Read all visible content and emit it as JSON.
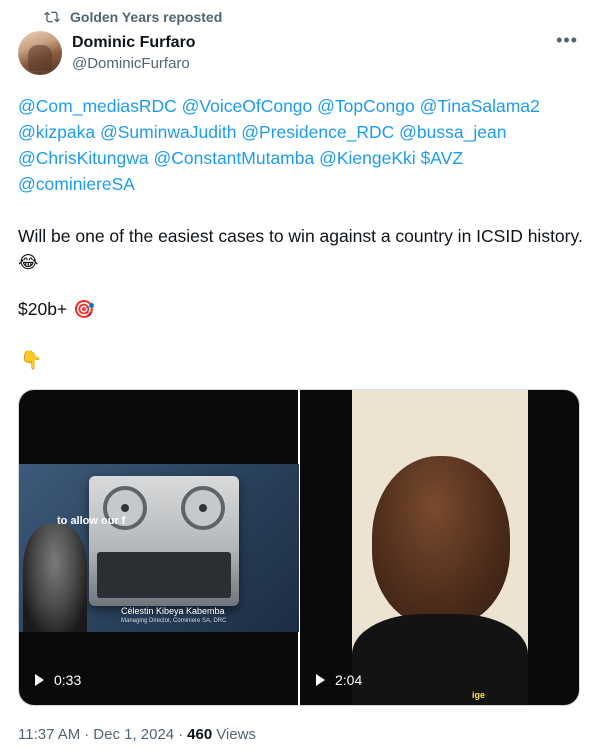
{
  "repost": {
    "icon": "repost-icon",
    "label": "Golden Years reposted"
  },
  "author": {
    "name": "Dominic Furfaro",
    "handle": "@DominicFurfaro",
    "avatar": "avatar"
  },
  "more_icon": "more-icon",
  "mentions": [
    "@Com_mediasRDC",
    "@VoiceOfCongo",
    "@TopCongo",
    "@TinaSalama2",
    "@kizpaka",
    "@SuminwaJudith",
    "@Presidence_RDC",
    "@bussa_jean",
    "@ChrisKitungwa",
    "@ConstantMutamba",
    "@KiengeKki",
    "$AVZ",
    "@cominiereSA"
  ],
  "body": {
    "text": "Will be one of the easiest cases to win against a country in ICSID history.",
    "emoji": "😂"
  },
  "price": {
    "text": "$20b+",
    "emoji": "🎯"
  },
  "pointer_emoji": "👇",
  "videos": [
    {
      "duration": "0:33",
      "caption": "to allow our f",
      "person_name": "Célestin Kibeya Kabemba",
      "person_role": "Managing Director, Cominiere SA, DRC"
    },
    {
      "duration": "2:04",
      "caption": "ige"
    }
  ],
  "meta": {
    "time": "11:37 AM",
    "date": "Dec 1, 2024",
    "views_count": "460",
    "views_label": "Views"
  },
  "colors": {
    "link": "#1d9bf0",
    "muted": "#536471",
    "text": "#0f1419"
  }
}
